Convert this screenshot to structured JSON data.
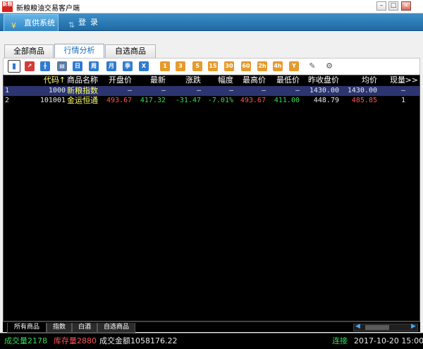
{
  "window": {
    "title": "新粮粮油交易客户端",
    "icon_text": "新粮"
  },
  "nav": {
    "tabs": [
      {
        "label": "直供系统",
        "icon": "yen-icon"
      },
      {
        "label": "登录",
        "icon": "login-icon"
      }
    ]
  },
  "subtabs": [
    "全部商品",
    "行情分析",
    "自选商品"
  ],
  "toolbar": {
    "buttons": [
      {
        "name": "bar-chart-icon",
        "glyph": "▮",
        "color": "#2f7bd0"
      },
      {
        "name": "line-chart-icon",
        "glyph": "↗",
        "color": "#d43b3b"
      },
      {
        "name": "candlestick-icon",
        "glyph": "╫",
        "color": "#2f7bd0"
      },
      {
        "name": "minute-chart-icon",
        "glyph": "▤",
        "color": "#5b7aa6"
      },
      {
        "name": "day-icon",
        "glyph": "日",
        "color": "#2f7bd0"
      },
      {
        "name": "week-icon",
        "glyph": "周",
        "color": "#2f7bd0"
      },
      {
        "name": "month-icon",
        "glyph": "月",
        "color": "#2f7bd0"
      },
      {
        "name": "quarter-icon",
        "glyph": "季",
        "color": "#2f7bd0"
      },
      {
        "name": "year-icon",
        "glyph": "X",
        "color": "#2f7bd0"
      },
      {
        "name": "period-1-icon",
        "glyph": "1",
        "color": "#e49b2b"
      },
      {
        "name": "period-3-icon",
        "glyph": "3",
        "color": "#e49b2b"
      },
      {
        "name": "period-5-icon",
        "glyph": "5",
        "color": "#e49b2b"
      },
      {
        "name": "period-15-icon",
        "glyph": "15",
        "color": "#e49b2b"
      },
      {
        "name": "period-30-icon",
        "glyph": "30",
        "color": "#e49b2b"
      },
      {
        "name": "period-60-icon",
        "glyph": "60",
        "color": "#e49b2b"
      },
      {
        "name": "period-2h-icon",
        "glyph": "2h",
        "color": "#e49b2b"
      },
      {
        "name": "period-4h-icon",
        "glyph": "4h",
        "color": "#e49b2b"
      },
      {
        "name": "period-y-icon",
        "glyph": "Y",
        "color": "#e49b2b"
      },
      {
        "name": "drawing-icon",
        "glyph": "✎",
        "color": "#ffffff"
      },
      {
        "name": "gear-icon",
        "glyph": "⚙",
        "color": "#ffffff"
      }
    ]
  },
  "grid": {
    "headers": [
      "代码↑",
      "商品名称",
      "开盘价",
      "最新",
      "涨跌",
      "幅度",
      "最高价",
      "最低价",
      "昨收盘价",
      "均价",
      "现量",
      ">>"
    ],
    "rows": [
      [
        "1",
        "1000",
        "新粮指数",
        "—",
        "—",
        "—",
        "—",
        "—",
        "—",
        "1430.00",
        "1430.00",
        "—"
      ],
      [
        "2",
        "101001",
        "金运恒通",
        "493.67",
        "417.32",
        "-31.47",
        "-7.01%",
        "493.67",
        "411.00",
        "448.79",
        "485.85",
        "1"
      ]
    ],
    "colors": {
      "up": "#ff5555",
      "down": "#33dd55",
      "neutral": "#e8e8e8",
      "name": "#ffff66",
      "header": "#ffffff"
    }
  },
  "bottom_tabs": [
    "所有商品",
    "指数",
    "白酒",
    "自选商品"
  ],
  "status": {
    "volume": "成交量2178",
    "inventory": "库存量2880",
    "turnover": "成交金额1058176.22",
    "connection": "连接",
    "datetime": "2017-10-20 15:00"
  }
}
